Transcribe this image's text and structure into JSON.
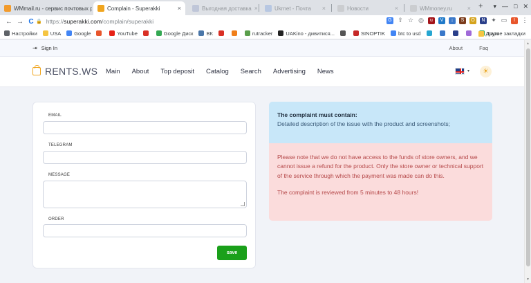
{
  "browser": {
    "tabs": [
      {
        "title": "WMmail.ru - сервис почтовых ра",
        "close": "×",
        "fav_color": "#f29b2c"
      },
      {
        "title": "Complain - Superakki",
        "close": "×",
        "fav_color": "#f0a51f"
      },
      {
        "title": "Выгодная доставка",
        "close": "×",
        "fav_color": "#9aa6c9"
      },
      {
        "title": "Ukrnet - Почта",
        "close": "×",
        "fav_color": "#8aa9de"
      },
      {
        "title": "Новости",
        "close": "×",
        "fav_color": "#b6b6b6"
      },
      {
        "title": "WMmoney.ru",
        "close": "×",
        "fav_color": "#b6b6b6"
      }
    ],
    "new_tab": "+",
    "window_controls": [
      "▾",
      "—",
      "□",
      "✕"
    ],
    "nav": {
      "back": "←",
      "forward": "→",
      "reload": "C"
    },
    "url": {
      "scheme": "https://",
      "host": "superakki.com",
      "path": "/complain/superakki",
      "lock": "🔒"
    },
    "extensions": [
      {
        "icon": "google-icon",
        "glyph": "G",
        "color": "#4285f4"
      },
      {
        "icon": "share-icon",
        "glyph": "⇧",
        "color": ""
      },
      {
        "icon": "star-icon",
        "glyph": "☆",
        "color": ""
      },
      {
        "icon": "globe-icon",
        "glyph": "◎",
        "color": ""
      },
      {
        "icon": "ublock-icon",
        "glyph": "u",
        "color": "#a3141a"
      },
      {
        "icon": "ext-v-icon",
        "glyph": "V",
        "color": "#1f79c9"
      },
      {
        "icon": "ext-dl-icon",
        "glyph": "↓",
        "color": "#3a78c9"
      },
      {
        "icon": "ext-s-icon",
        "glyph": "S",
        "color": "#7a3a1a"
      },
      {
        "icon": "ext-o-icon",
        "glyph": "O",
        "color": "#d5a31c"
      },
      {
        "icon": "ext-n-icon",
        "glyph": "N",
        "color": "#2a3f8a"
      },
      {
        "icon": "puzzle-icon",
        "glyph": "✦",
        "color": ""
      },
      {
        "icon": "sidepanel-icon",
        "glyph": "▭",
        "color": ""
      },
      {
        "icon": "profile-icon",
        "glyph": "I",
        "color": "#e8562c"
      },
      {
        "icon": "menu-icon",
        "glyph": "⋮",
        "color": ""
      }
    ],
    "bookmarks": [
      {
        "label": "Настройки",
        "color": "#5f6368",
        "icon": "gear-icon"
      },
      {
        "label": "USA",
        "color": "#f5c542",
        "icon": "folder-icon"
      },
      {
        "label": "Google",
        "color": "#4285f4",
        "icon": "google-icon"
      },
      {
        "label": "",
        "color": "#e8562c",
        "icon": "ext-icon"
      },
      {
        "label": "YouTube",
        "color": "#e62117",
        "icon": "youtube-icon"
      },
      {
        "label": "",
        "color": "#d93025",
        "icon": "gmail-icon"
      },
      {
        "label": "Google Диск",
        "color": "#34a853",
        "icon": "drive-icon"
      },
      {
        "label": "ВК",
        "color": "#4a76a8",
        "icon": "vk-icon"
      },
      {
        "label": "",
        "color": "#d93025",
        "icon": "ext-icon"
      },
      {
        "label": "",
        "color": "#f07f1a",
        "icon": "ext-icon"
      },
      {
        "label": "rutracker",
        "color": "#5a9e4b",
        "icon": "rutracker-icon"
      },
      {
        "label": "UAKino - дивитися...",
        "color": "#222",
        "icon": "uakino-icon"
      },
      {
        "label": "",
        "color": "#555",
        "icon": "ext-icon"
      },
      {
        "label": "SINOPTIK",
        "color": "#c62828",
        "icon": "sinoptik-icon"
      },
      {
        "label": "btc to usd",
        "color": "#4285f4",
        "icon": "google-icon"
      },
      {
        "label": "",
        "color": "#26a6d1",
        "icon": "ext-icon"
      },
      {
        "label": "",
        "color": "#3a78c9",
        "icon": "ext-icon"
      },
      {
        "label": "",
        "color": "#2a3f8a",
        "icon": "ext-icon"
      },
      {
        "label": "",
        "color": "#a06ad8",
        "icon": "ext-icon"
      },
      {
        "label": "maps",
        "color": "#34a853",
        "icon": "maps-icon"
      }
    ],
    "other_bookmarks": "Другие закладки"
  },
  "page": {
    "topbar": {
      "signin": "Sign In",
      "about": "About",
      "faq": "Faq"
    },
    "logo": "RENTS.WS",
    "nav": [
      "Main",
      "About",
      "Top deposit",
      "Catalog",
      "Search",
      "Advertising",
      "News"
    ],
    "lang_caret": "▾",
    "theme_icon": "☀",
    "form": {
      "email_label": "EMAIL",
      "telegram_label": "TELEGRAM",
      "message_label": "MESSAGE",
      "order_label": "ORDER",
      "save": "save",
      "email_value": "",
      "telegram_value": "",
      "message_value": "",
      "order_value": ""
    },
    "info": {
      "title": "The complaint must contain:",
      "detail": "Detailed description of the issue with the product and screenshots;",
      "warning": "Please note that we do not have access to the funds of store owners, and we cannot issue a refund for the product. Only the store owner or technical support of the service through which the payment was made can do this.",
      "review": "The complaint is reviewed from 5 minutes to 48 hours!"
    },
    "colors": {
      "accent": "#f0a51f",
      "save": "#1aa01a",
      "info_blue": "#c8e7f9",
      "info_red": "#fbdcdc",
      "warning_text": "#b5494a"
    }
  }
}
